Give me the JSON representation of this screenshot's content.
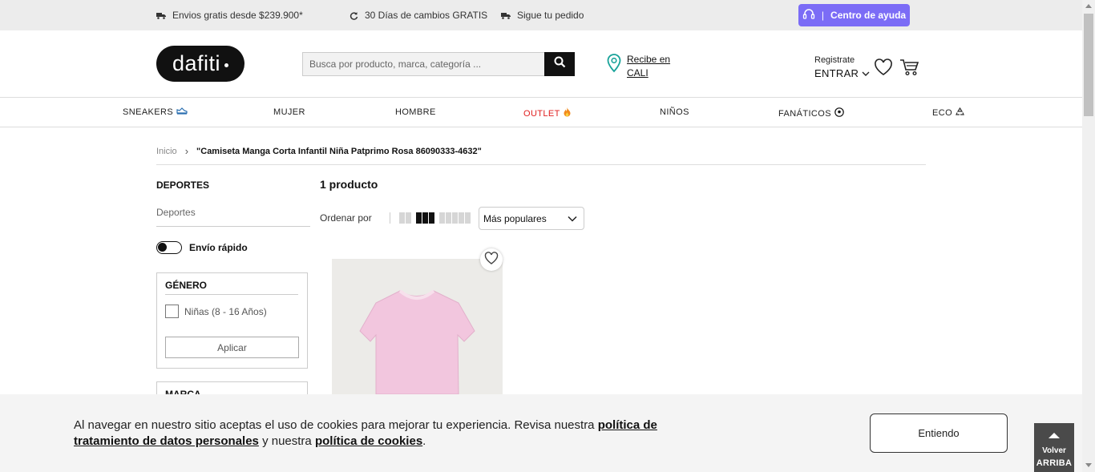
{
  "topbar": {
    "shipping": "Envios gratis desde $239.900*",
    "returns": "30 Días de cambios GRATIS",
    "track": "Sigue tu pedido",
    "help": "Centro de ayuda",
    "help_sep": "|"
  },
  "header": {
    "logo": "dafiti",
    "search_placeholder": "Busca por producto, marca, categoría ...",
    "location_line1": "Recibe en",
    "location_line2": "CALI",
    "register": "Registrate",
    "login": "ENTRAR"
  },
  "nav": {
    "items": [
      {
        "label": "SNEAKERS",
        "icon": "sneaker-icon"
      },
      {
        "label": "MUJER"
      },
      {
        "label": "HOMBRE"
      },
      {
        "label": "OUTLET",
        "icon": "fire-icon"
      },
      {
        "label": "NIÑOS"
      },
      {
        "label": "FANÁTICOS",
        "icon": "soccer-ball-icon"
      },
      {
        "label": "ECO",
        "icon": "recycle-icon"
      }
    ]
  },
  "breadcrumb": {
    "home": "Inicio",
    "separator": "›",
    "current": "\"Camiseta Manga Corta Infantil Niña Patprimo Rosa 86090333-4632\""
  },
  "sidebar": {
    "section_title": "DEPORTES",
    "section_link": "Deportes",
    "fast_shipping": "Envío rápido",
    "gender_title": "GÉNERO",
    "gender_option": "Niñas (8 - 16 Años)",
    "apply": "Aplicar",
    "brand_title": "MARCA"
  },
  "results": {
    "count": "1 producto",
    "sort_label": "Ordenar por",
    "sort_value": "Más populares"
  },
  "product": {
    "color": "#f2c6de"
  },
  "cookie": {
    "text1": "Al navegar en nuestro sitio aceptas el uso de cookies para mejorar tu experiencia. Revisa nuestra ",
    "link1": "política de tratamiento de datos personales",
    "text2": " y nuestra ",
    "link2": "política de cookies",
    "text3": ".",
    "button": "Entiendo"
  },
  "back_to_top": {
    "line1": "Volver",
    "line2": "ARRIBA"
  },
  "colors": {
    "accent": "#7b6cf6",
    "outlet": "#e02020",
    "location_icon": "#1aa39a"
  }
}
